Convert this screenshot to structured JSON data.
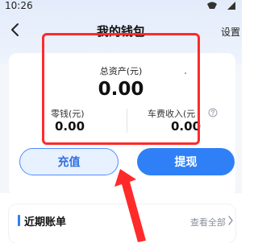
{
  "status_bar": {
    "time": "10:26"
  },
  "header": {
    "title": "我的钱包",
    "settings_label": "设置"
  },
  "wallet": {
    "total_label": "总资产(元)",
    "total_value": "0.00",
    "change_label": "零钱(元)",
    "change_value": "0.00",
    "income_label": "车费收入(元",
    "income_value": "0.00"
  },
  "actions": {
    "recharge_label": "充值",
    "withdraw_label": "提现"
  },
  "bills": {
    "title": "近期账单",
    "view_all_label": "查看全部"
  },
  "colors": {
    "accent": "#2f80f6",
    "highlight": "#ff2a2a",
    "annotation_arrow": "#ff2a2a"
  },
  "icons": [
    "back-icon",
    "help-icon",
    "chevron-right-icon",
    "wifi-icon",
    "signal-icon"
  ]
}
